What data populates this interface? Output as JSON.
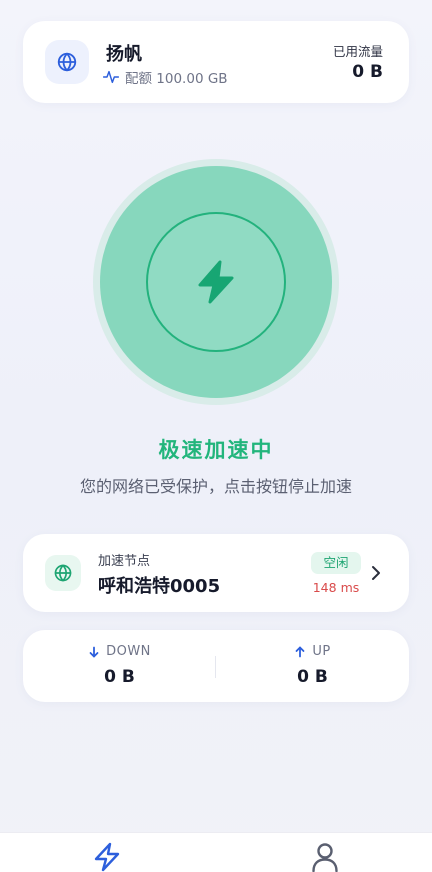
{
  "account": {
    "name": "扬帆",
    "quota": "配额 100.00 GB",
    "usage_label": "已用流量",
    "usage_value": "0 B"
  },
  "power": {
    "state": "on",
    "icon": "lightning-bolt-icon"
  },
  "status": {
    "title": "极速加速中",
    "description": "您的网络已受保护，点击按钮停止加速"
  },
  "node": {
    "label": "加速节点",
    "name": "呼和浩特0005",
    "badge": "空闲",
    "latency": "148 ms"
  },
  "traffic": {
    "down_label": "DOWN",
    "down_value": "0 B",
    "up_label": "UP",
    "up_value": "0 B"
  },
  "nav": {
    "items": [
      {
        "icon": "lightning-bolt-icon",
        "active": true
      },
      {
        "icon": "user-icon",
        "active": false
      }
    ]
  },
  "colors": {
    "accent_green": "#22b57c",
    "accent_blue": "#2d5fdc",
    "latency_red": "#d94b4b"
  }
}
